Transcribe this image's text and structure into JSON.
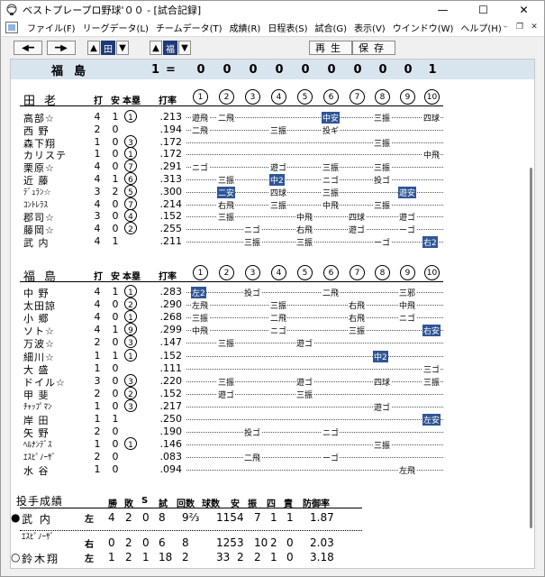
{
  "window": {
    "title": "ベストプレープロ野球'００ - [試合記録]"
  },
  "menu": [
    "ファイル(F)",
    "リーグデータ(L)",
    "チームデータ(T)",
    "成績(R)",
    "日程表(S)",
    "試合(G)",
    "表示(V)",
    "ウインドウ(W)",
    "ヘルプ(H)"
  ],
  "toolbar": {
    "home_label": "田",
    "visitor_label": "福",
    "replay_label": "再生",
    "save_label": "保存"
  },
  "score": {
    "team": "福島",
    "total": "1",
    "eq": "=",
    "innings": [
      "0",
      "0",
      "0",
      "0",
      "0",
      "0",
      "0",
      "0",
      "0",
      "1"
    ]
  },
  "columns": {
    "ab": "打",
    "h": "安",
    "hr": "本塁",
    "avg": "打率"
  },
  "inning_nums": [
    "1",
    "2",
    "3",
    "4",
    "5",
    "6",
    "7",
    "8",
    "9",
    "10"
  ],
  "home": {
    "team": "田老",
    "batters": [
      {
        "name": "高部☆",
        "ab": "4",
        "h": "1",
        "hr": "1",
        "avg": ".213",
        "results": [
          "遊飛",
          "二飛",
          "",
          "",
          "",
          "中安",
          "",
          "三振",
          "",
          "四球"
        ]
      },
      {
        "name": "西 野",
        "ab": "2",
        "h": "0",
        "hr": "",
        "avg": ".194",
        "results": [
          "二飛",
          "",
          "",
          "三振",
          "",
          "投ギ",
          "",
          "",
          "",
          "",
          ""
        ]
      },
      {
        "name": "森下翔",
        "ab": "1",
        "h": "0",
        "hr": "3",
        "avg": ".172",
        "results": [
          "",
          "",
          "",
          "",
          "",
          "",
          "",
          "三振",
          "",
          ""
        ]
      },
      {
        "name": "カリステ",
        "ab": "1",
        "h": "0",
        "hr": "1",
        "avg": ".172",
        "results": [
          "",
          "",
          "",
          "",
          "",
          "",
          "",
          "",
          "",
          "中飛"
        ]
      },
      {
        "name": "栗原☆",
        "ab": "4",
        "h": "0",
        "hr": "7",
        "avg": ".291",
        "results": [
          "ニゴ",
          "",
          "",
          "遊ゴ",
          "",
          "三振",
          "",
          "三振",
          "",
          ""
        ]
      },
      {
        "name": "近 藤",
        "ab": "4",
        "h": "1",
        "hr": "6",
        "avg": ".313",
        "results": [
          "",
          "三振",
          "",
          "中2",
          "",
          "ニゴ",
          "",
          "投ゴ",
          "",
          ""
        ]
      },
      {
        "name": "ﾃﾞｭﾗﾝ☆",
        "ab": "3",
        "h": "2",
        "hr": "5",
        "avg": ".300",
        "results": [
          "",
          "二安",
          "",
          "四球",
          "",
          "三振",
          "",
          "",
          "遊安",
          ""
        ]
      },
      {
        "name": "ｺﾝﾄﾚﾗｽ",
        "ab": "4",
        "h": "0",
        "hr": "7",
        "avg": ".214",
        "results": [
          "",
          "右飛",
          "",
          "三振",
          "",
          "中飛",
          "",
          "三振",
          "",
          ""
        ]
      },
      {
        "name": "郡司☆",
        "ab": "3",
        "h": "0",
        "hr": "4",
        "avg": ".152",
        "results": [
          "",
          "三振",
          "",
          "",
          "中飛",
          "",
          "四球",
          "",
          "遊ゴ",
          ""
        ]
      },
      {
        "name": "藤岡☆",
        "ab": "4",
        "h": "0",
        "hr": "2",
        "avg": ".255",
        "results": [
          "",
          "",
          "ニゴ",
          "",
          "右飛",
          "",
          "遊ゴ",
          "",
          "ーゴ",
          ""
        ]
      },
      {
        "name": "武 内",
        "ab": "4",
        "h": "1",
        "hr": "",
        "avg": ".211",
        "results": [
          "",
          "",
          "三振",
          "",
          "三振",
          "",
          "",
          "ーゴ",
          "",
          "右2"
        ]
      }
    ]
  },
  "visitor": {
    "team": "福島",
    "batters": [
      {
        "name": "中 野",
        "ab": "4",
        "h": "1",
        "hr": "1",
        "avg": ".283",
        "results": [
          "左2",
          "",
          "投ゴ",
          "",
          "",
          "二飛",
          "",
          "",
          "三邪",
          ""
        ]
      },
      {
        "name": "太田諒",
        "ab": "4",
        "h": "0",
        "hr": "2",
        "avg": ".290",
        "results": [
          "左飛",
          "",
          "",
          "三振",
          "",
          "",
          "右飛",
          "",
          "中飛",
          ""
        ]
      },
      {
        "name": "小 郷",
        "ab": "4",
        "h": "0",
        "hr": "1",
        "avg": ".268",
        "results": [
          "三振",
          "",
          "",
          "二飛",
          "",
          "",
          "右飛",
          "",
          "ニゴ",
          ""
        ]
      },
      {
        "name": "ソト☆",
        "ab": "4",
        "h": "1",
        "hr": "9",
        "avg": ".299",
        "results": [
          "中飛",
          "",
          "",
          "ニゴ",
          "",
          "",
          "三振",
          "",
          "",
          "右安"
        ]
      },
      {
        "name": "万波☆",
        "ab": "2",
        "h": "0",
        "hr": "3",
        "avg": ".147",
        "results": [
          "",
          "三振",
          "",
          "",
          "遊ゴ",
          "",
          "",
          "",
          "",
          ""
        ]
      },
      {
        "name": "細川☆",
        "ab": "1",
        "h": "1",
        "hr": "1",
        "avg": ".152",
        "results": [
          "",
          "",
          "",
          "",
          "",
          "",
          "",
          "中2",
          "",
          ""
        ]
      },
      {
        "name": "大 盛",
        "ab": "1",
        "h": "0",
        "hr": "",
        "avg": ".111",
        "results": [
          "",
          "",
          "",
          "",
          "",
          "",
          "",
          "",
          "",
          "三ゴ"
        ]
      },
      {
        "name": "ドイル☆",
        "ab": "3",
        "h": "0",
        "hr": "3",
        "avg": ".220",
        "results": [
          "",
          "三振",
          "",
          "",
          "遊ゴ",
          "",
          "",
          "四球",
          "",
          "三振"
        ]
      },
      {
        "name": "甲 斐",
        "ab": "2",
        "h": "0",
        "hr": "2",
        "avg": ".152",
        "results": [
          "",
          "遊ゴ",
          "",
          "",
          "三振",
          "",
          "",
          "",
          "",
          ""
        ]
      },
      {
        "name": "ﾁｬｯﾌﾟﾏﾝ",
        "ab": "1",
        "h": "0",
        "hr": "3",
        "avg": ".217",
        "results": [
          "",
          "",
          "",
          "",
          "",
          "",
          "",
          "遊ゴ",
          "",
          ""
        ]
      },
      {
        "name": "岸 田",
        "ab": "1",
        "h": "1",
        "hr": "",
        "avg": ".250",
        "results": [
          "",
          "",
          "",
          "",
          "",
          "",
          "",
          "",
          "",
          "左安"
        ]
      },
      {
        "name": "矢 野",
        "ab": "2",
        "h": "0",
        "hr": "",
        "avg": ".190",
        "results": [
          "",
          "",
          "投ゴ",
          "",
          "",
          "ニゴ",
          "",
          "",
          "",
          ""
        ]
      },
      {
        "name": "ﾍﾙﾅﾝﾃﾞｽ",
        "ab": "1",
        "h": "0",
        "hr": "1",
        "avg": ".146",
        "results": [
          "",
          "",
          "",
          "",
          "",
          "",
          "",
          "三振",
          "",
          ""
        ]
      },
      {
        "name": "ｴｽﾋﾟﾉｰｻﾞ",
        "ab": "2",
        "h": "0",
        "hr": "",
        "avg": ".083",
        "results": [
          "",
          "",
          "二飛",
          "",
          "",
          "ーゴ",
          "",
          "",
          "",
          ""
        ]
      },
      {
        "name": "水 谷",
        "ab": "1",
        "h": "0",
        "hr": "",
        "avg": ".094",
        "results": [
          "",
          "",
          "",
          "",
          "",
          "",
          "",
          "",
          "左飛",
          ""
        ]
      }
    ]
  },
  "pitching": {
    "title": "投手成績",
    "headers": [
      "勝",
      "敗",
      "S",
      "試",
      "回数",
      "球数",
      "安",
      "振",
      "四",
      "責",
      "防御率"
    ],
    "pitchers": [
      {
        "mark": "●",
        "name": "武 内",
        "hand": "左",
        "w": "4",
        "l": "2",
        "s": "0",
        "g": "8",
        "ip": "9⅔",
        "np": "115",
        "h": "4",
        "k": "7",
        "bb": "1",
        "er": "1",
        "era": "1.87"
      },
      {
        "mark": "",
        "name": "ｴｽﾋﾟﾉｰｻﾞ",
        "hand": "右",
        "w": "0",
        "l": "2",
        "s": "0",
        "g": "6",
        "ip": "8",
        "np": "125",
        "h": "3",
        "k": "10",
        "bb": "2",
        "er": "0",
        "era": "2.03"
      },
      {
        "mark": "○",
        "name": "鈴木翔",
        "hand": "左",
        "w": "1",
        "l": "2",
        "s": "1",
        "g": "18",
        "ip": "2",
        "np": "33",
        "h": "2",
        "k": "2",
        "bb": "1",
        "er": "0",
        "era": "3.18"
      }
    ]
  }
}
